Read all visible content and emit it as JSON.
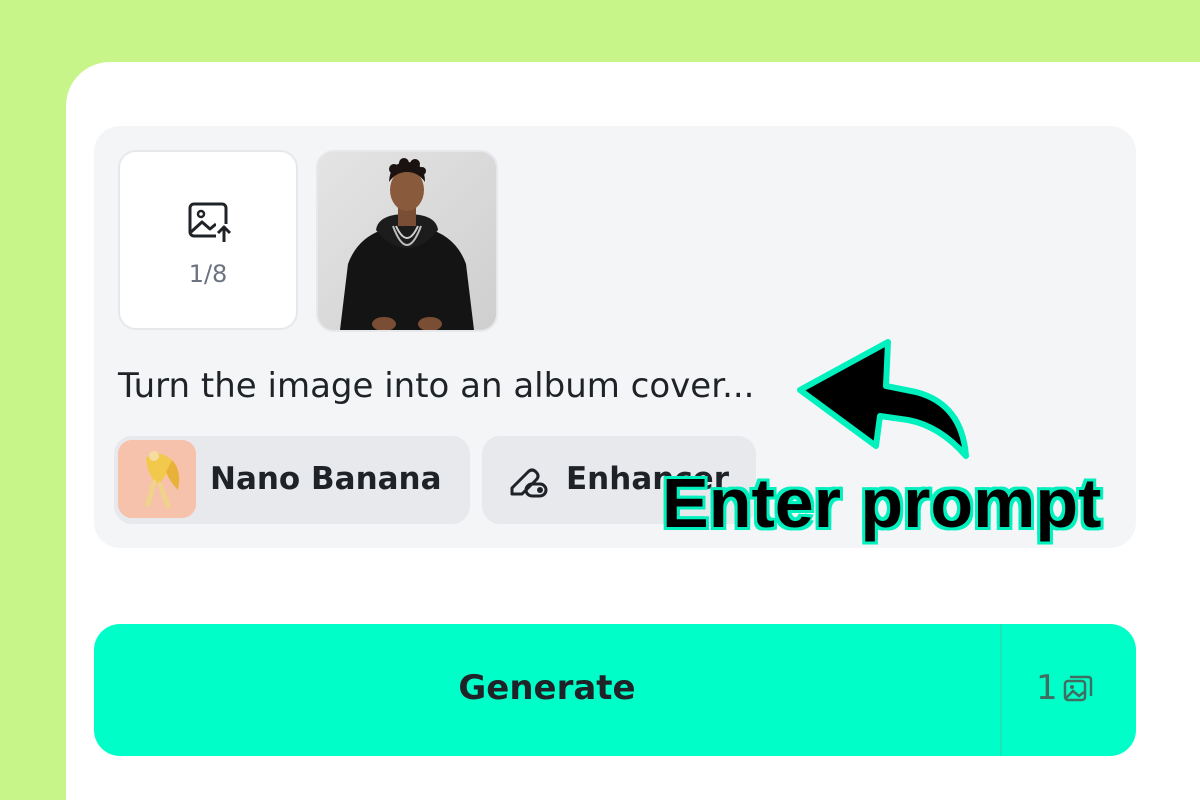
{
  "upload": {
    "count_label": "1/8",
    "icon": "image-upload-icon"
  },
  "prompt": {
    "text": "Turn the image into an album cover..."
  },
  "chips": {
    "model_label": "Nano Banana",
    "enhancer_label": "Enhancer"
  },
  "generate": {
    "label": "Generate",
    "credit": "1",
    "credit_icon": "images-icon"
  },
  "annotation": {
    "text": "Enter prompt",
    "arrow_icon": "curved-arrow-icon"
  },
  "colors": {
    "background": "#c8f58a",
    "accent": "#00ffc8",
    "annotation_outline": "#00f0be"
  }
}
